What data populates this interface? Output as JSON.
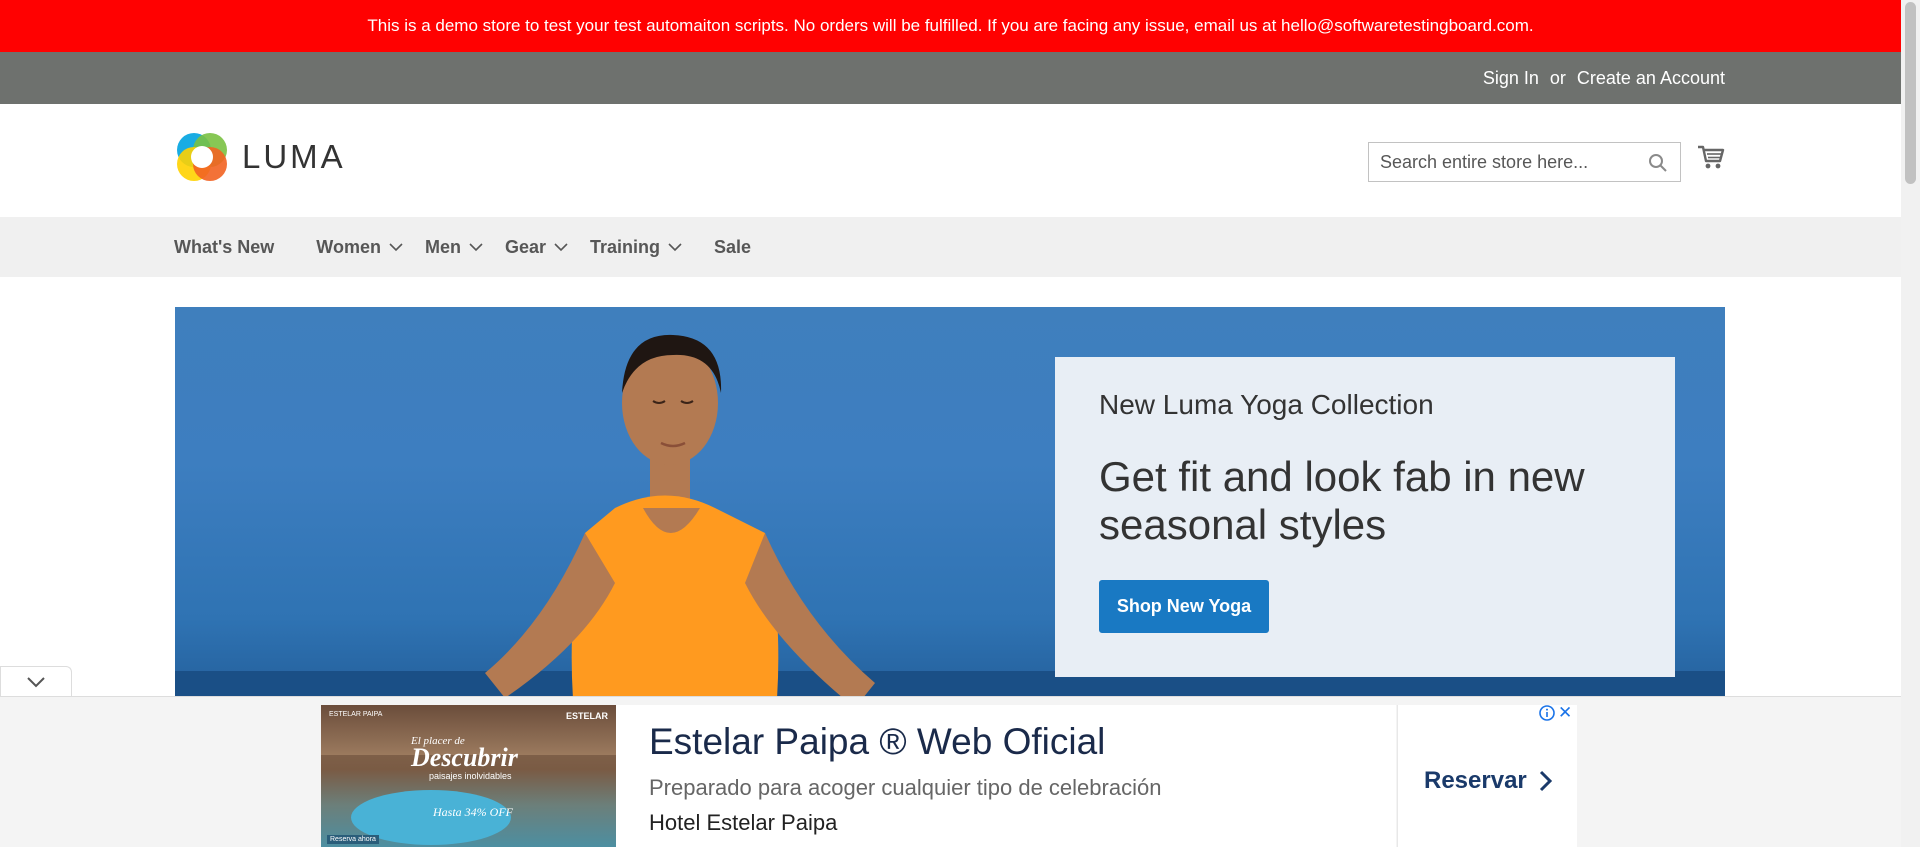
{
  "demo_notice": "This is a demo store to test your test automaiton scripts. No orders will be fulfilled. If you are facing any issue, email us at hello@softwaretestingboard.com.",
  "panel": {
    "sign_in": "Sign In",
    "or": "or",
    "create_account": "Create an Account"
  },
  "header": {
    "logo_text": "LUMA",
    "search_placeholder": "Search entire store here..."
  },
  "nav": {
    "items": [
      {
        "label": "What's New",
        "has_dropdown": false
      },
      {
        "label": "Women",
        "has_dropdown": true
      },
      {
        "label": "Men",
        "has_dropdown": true
      },
      {
        "label": "Gear",
        "has_dropdown": true
      },
      {
        "label": "Training",
        "has_dropdown": true
      },
      {
        "label": "Sale",
        "has_dropdown": false
      }
    ]
  },
  "hero": {
    "subtitle": "New Luma Yoga Collection",
    "title": "Get fit and look fab in new seasonal styles",
    "button": "Shop New Yoga"
  },
  "ad": {
    "image_tl": "ESTELAR PAIPA",
    "image_tr": "ESTELAR",
    "image_line1": "El placer de",
    "image_line2": "Descubrir",
    "image_line3": "paisajes inolvidables",
    "image_line4": "Hasta 34% OFF",
    "image_bl": "Reserva ahora",
    "title": "Estelar Paipa ® Web Oficial",
    "description": "Preparado para acoger cualquier tipo de celebración",
    "advertiser": "Hotel Estelar Paipa",
    "cta": "Reservar"
  },
  "colors": {
    "demo_bar": "#ff0101",
    "panel": "#6e716e",
    "primary_button": "#1979c3",
    "nav_bg": "#f0f0f0"
  }
}
